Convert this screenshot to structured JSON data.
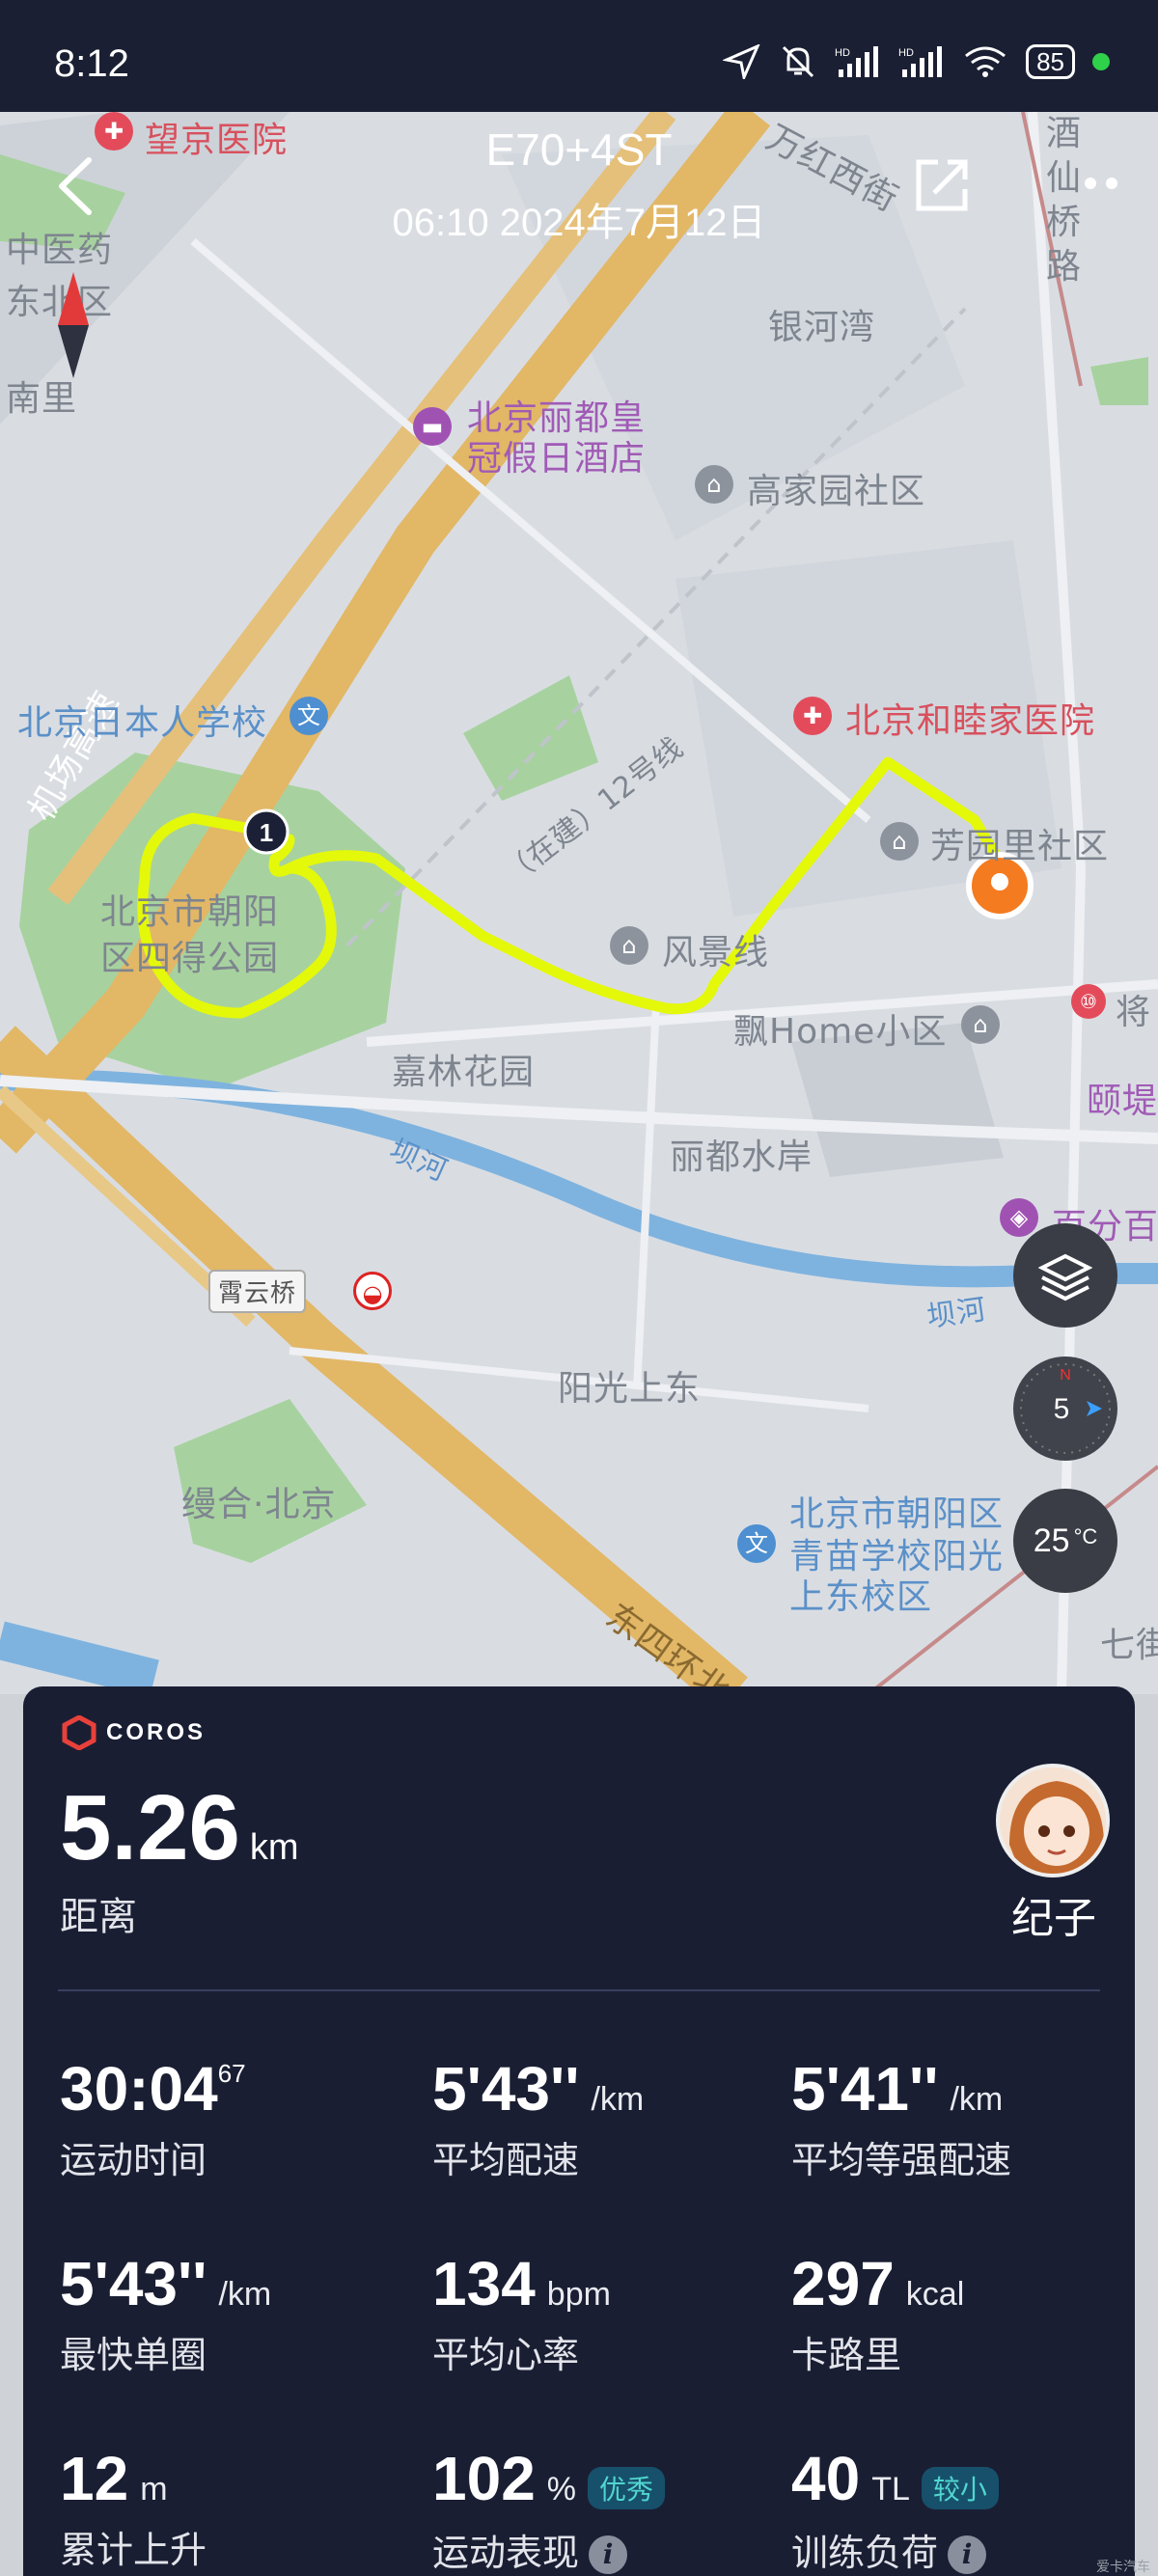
{
  "status_bar": {
    "time": "8:12",
    "battery": "85",
    "signal_label": "HD"
  },
  "header": {
    "title": "E70+4ST",
    "subtitle": "06:10 2024年7月12日"
  },
  "map": {
    "labels": {
      "wangjing": "望京医院",
      "zhongyiyao": "中医药",
      "dongba": "东北区",
      "nanli": "南里",
      "wanhong": "万红西街",
      "jiuxian": "酒仙桥路",
      "yinhewan": "银河湾",
      "lidu_hotel_1": "北京丽都皇",
      "lidu_hotel_2": "冠假日酒店",
      "gaojiayuan": "高家园社区",
      "jichang": "机场高速",
      "riben_school": "北京日本人学校",
      "hemujia": "北京和睦家医院",
      "fangyuanli": "芳园里社区",
      "chaoyang_park_1": "北京市朝阳",
      "chaoyang_park_2": "区四得公园",
      "fengjingxian": "风景线",
      "line12": "（在建）12号线",
      "piaohome": "飘Home小区",
      "jiang": "将",
      "jialin": "嘉林花园",
      "yi": "颐堤",
      "baihe_1": "坝河",
      "lidushuian": "丽都水岸",
      "baifen": "百分百",
      "xiayunqiao": "霄云桥",
      "baihe_2": "坝河",
      "yangguang": "阳光上东",
      "huanghe": "缦合·北京",
      "qingmiao_1": "北京市朝阳区",
      "qingmiao_2": "青苗学校阳光",
      "qingmiao_3": "上东校区",
      "dongsi": "东四环北",
      "qi": "七街"
    },
    "lap_marker": "1",
    "compass_value": "5",
    "temperature": "25",
    "temperature_unit": "°C"
  },
  "card": {
    "brand": "COROS",
    "distance_value": "5.26",
    "distance_unit": "km",
    "distance_label": "距离",
    "user_name": "纪子",
    "stats": [
      {
        "value": "30:04",
        "sup": "67",
        "unit": "",
        "label": "运动时间"
      },
      {
        "value": "5'43''",
        "unit": "/km",
        "label": "平均配速"
      },
      {
        "value": "5'41''",
        "unit": "/km",
        "label": "平均等强配速"
      },
      {
        "value": "5'43''",
        "unit": "/km",
        "label": "最快单圈"
      },
      {
        "value": "134",
        "unit": "bpm",
        "label": "平均心率"
      },
      {
        "value": "297",
        "unit": "kcal",
        "label": "卡路里"
      },
      {
        "value": "12",
        "unit": "m",
        "label": "累计上升"
      },
      {
        "value": "102",
        "unit": "%",
        "badge": "优秀",
        "label": "运动表现"
      },
      {
        "value": "40",
        "unit": "TL",
        "badge": "较小",
        "label": "训练负荷"
      }
    ]
  },
  "watermark": "爱卡汽车"
}
